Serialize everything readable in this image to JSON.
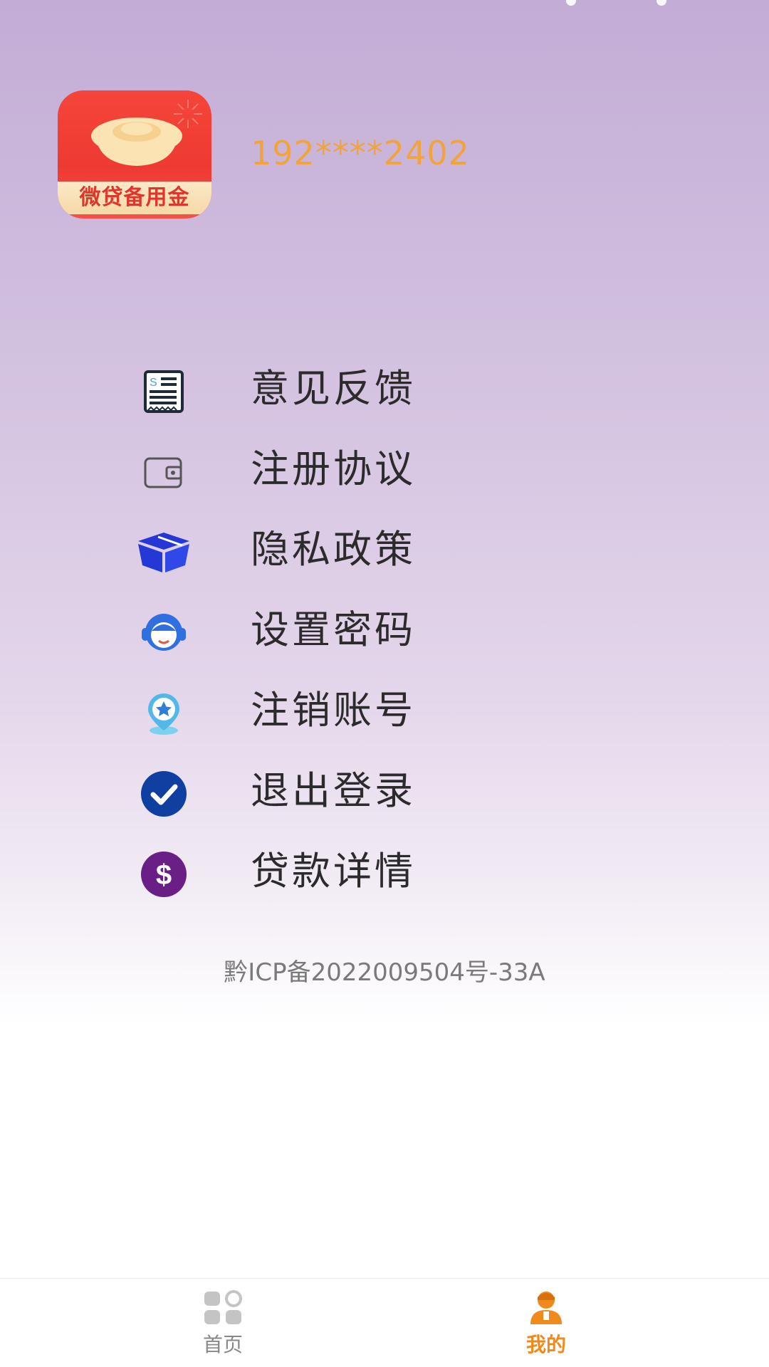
{
  "header": {
    "logo_text": "微贷备用金",
    "phone": "192****2402"
  },
  "menu": {
    "items": [
      {
        "label": "意见反馈",
        "icon": "receipt-icon"
      },
      {
        "label": "注册协议",
        "icon": "wallet-icon"
      },
      {
        "label": "隐私政策",
        "icon": "box-icon"
      },
      {
        "label": "设置密码",
        "icon": "headset-icon"
      },
      {
        "label": "注销账号",
        "icon": "location-star-icon"
      },
      {
        "label": "退出登录",
        "icon": "check-circle-icon"
      },
      {
        "label": "贷款详情",
        "icon": "dollar-circle-icon"
      }
    ]
  },
  "footer": {
    "icp": "黔ICP备2022009504号-33A"
  },
  "bottom_nav": {
    "home_label": "首页",
    "mine_label": "我的"
  },
  "colors": {
    "accent": "#f08a1c",
    "phone": "#f2a33a",
    "logo_red": "#ee3a32"
  }
}
